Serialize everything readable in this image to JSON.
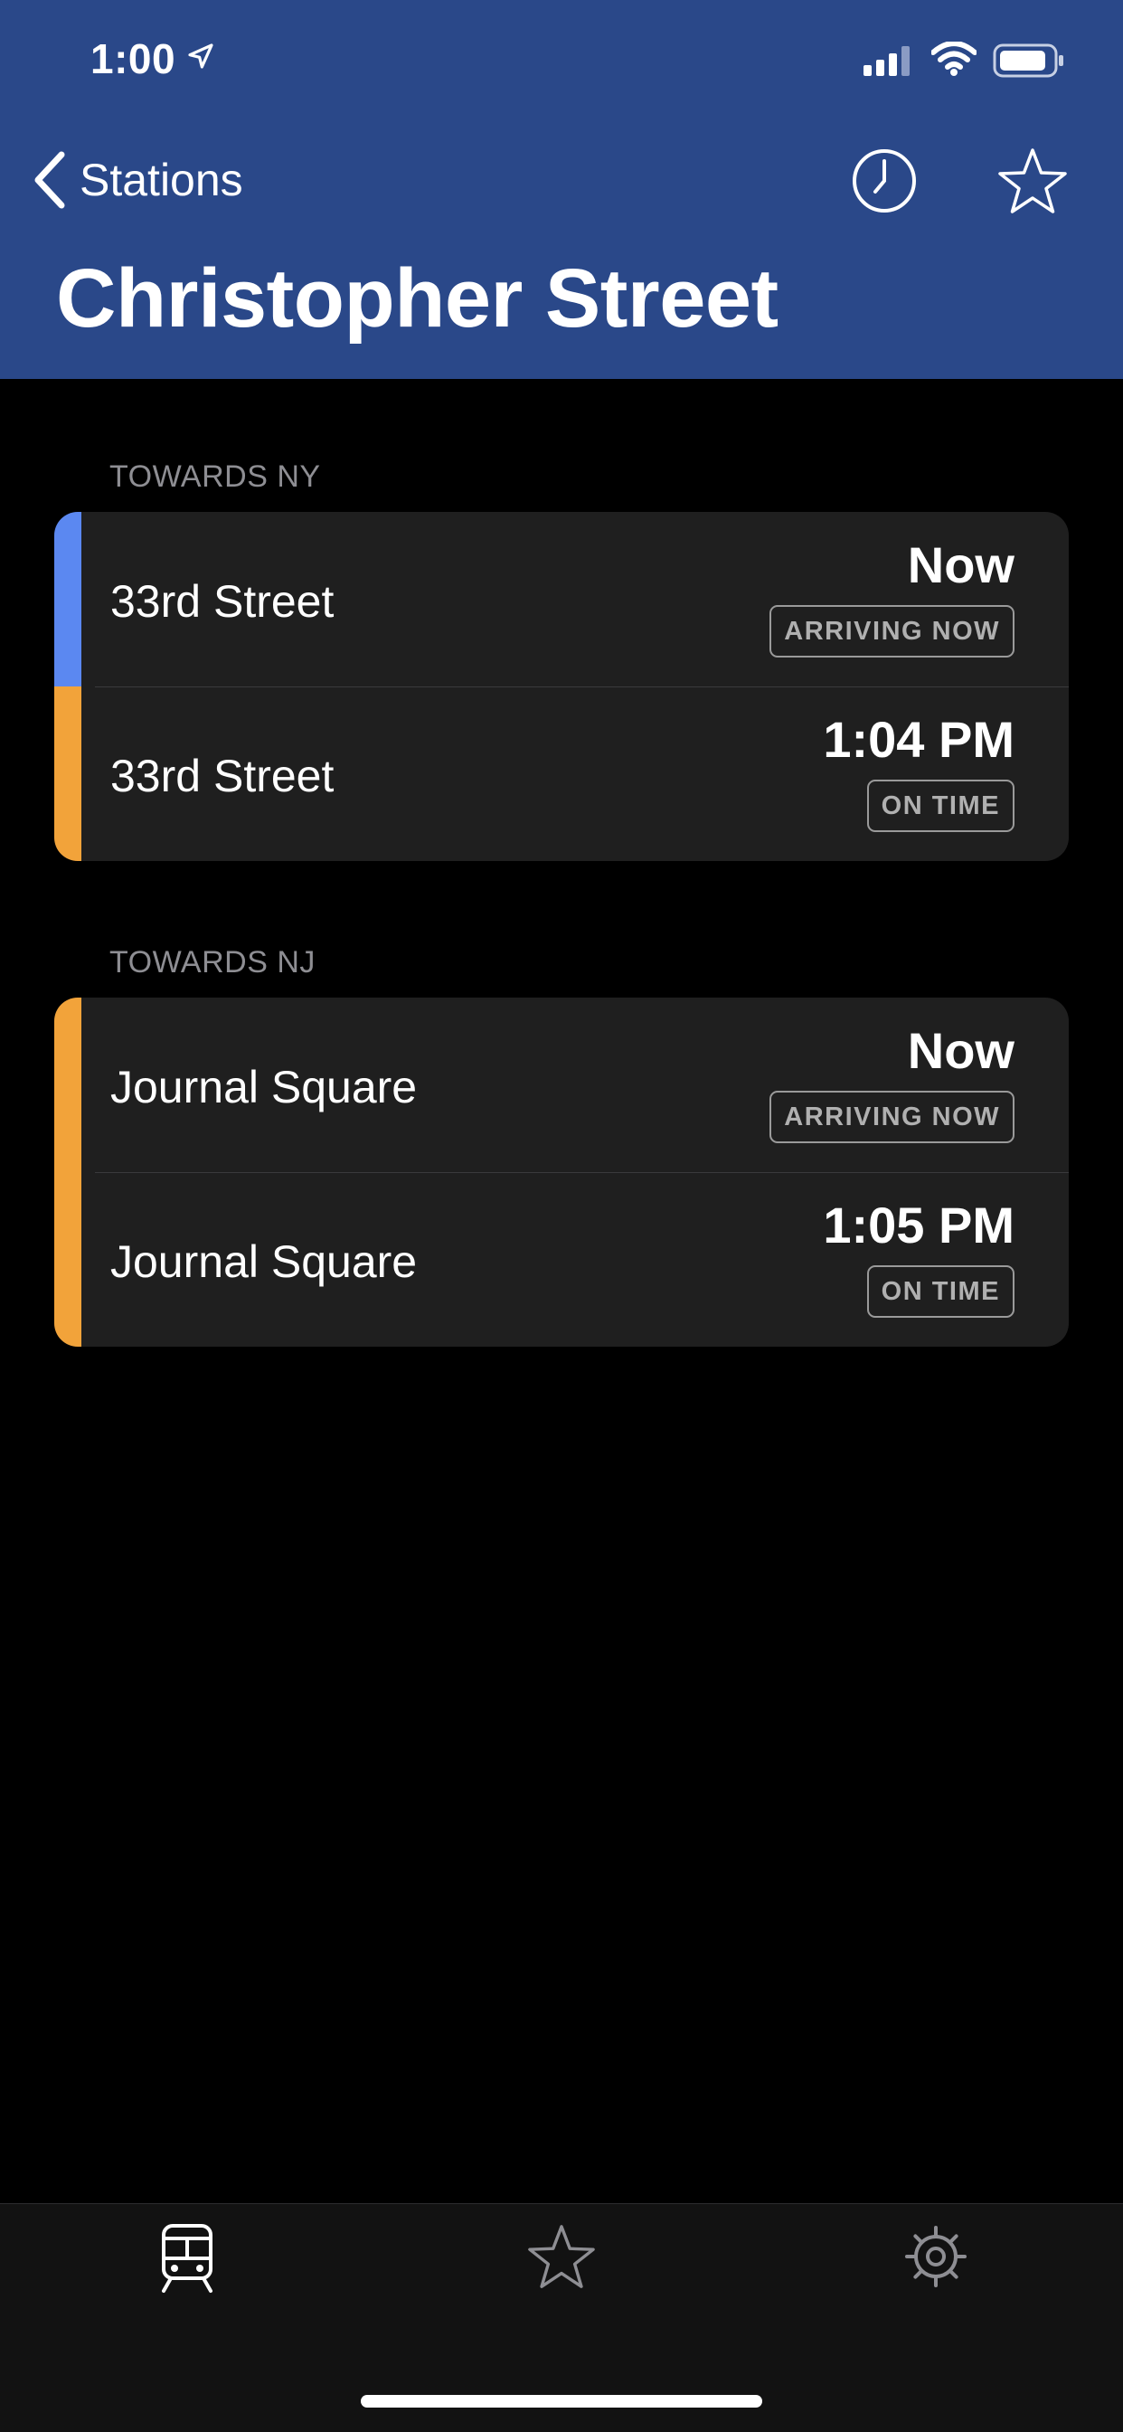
{
  "status_bar": {
    "time": "1:00",
    "icons": [
      "location-arrow-icon",
      "signal-icon",
      "wifi-icon",
      "battery-icon"
    ]
  },
  "nav": {
    "back_label": "Stations",
    "title": "Christopher Street",
    "icons": [
      "chevron-left-icon",
      "clock-icon",
      "star-icon"
    ]
  },
  "colors": {
    "header_bg": "#2a4889",
    "blue_line": "#5b88f1",
    "orange_line": "#f2a33a"
  },
  "sections": [
    {
      "header": "TOWARDS NY",
      "rows": [
        {
          "destination": "33rd Street",
          "time": "Now",
          "status": "ARRIVING NOW",
          "line_color": "#5b88f1"
        },
        {
          "destination": "33rd Street",
          "time": "1:04 PM",
          "status": "ON TIME",
          "line_color": "#f2a33a"
        }
      ]
    },
    {
      "header": "TOWARDS NJ",
      "rows": [
        {
          "destination": "Journal Square",
          "time": "Now",
          "status": "ARRIVING NOW",
          "line_color": "#f2a33a"
        },
        {
          "destination": "Journal Square",
          "time": "1:05 PM",
          "status": "ON TIME",
          "line_color": "#f2a33a"
        }
      ]
    }
  ],
  "tab_bar": {
    "tabs": [
      {
        "icon": "train-icon",
        "active": true
      },
      {
        "icon": "star-icon",
        "active": false
      },
      {
        "icon": "gear-icon",
        "active": false
      }
    ]
  }
}
